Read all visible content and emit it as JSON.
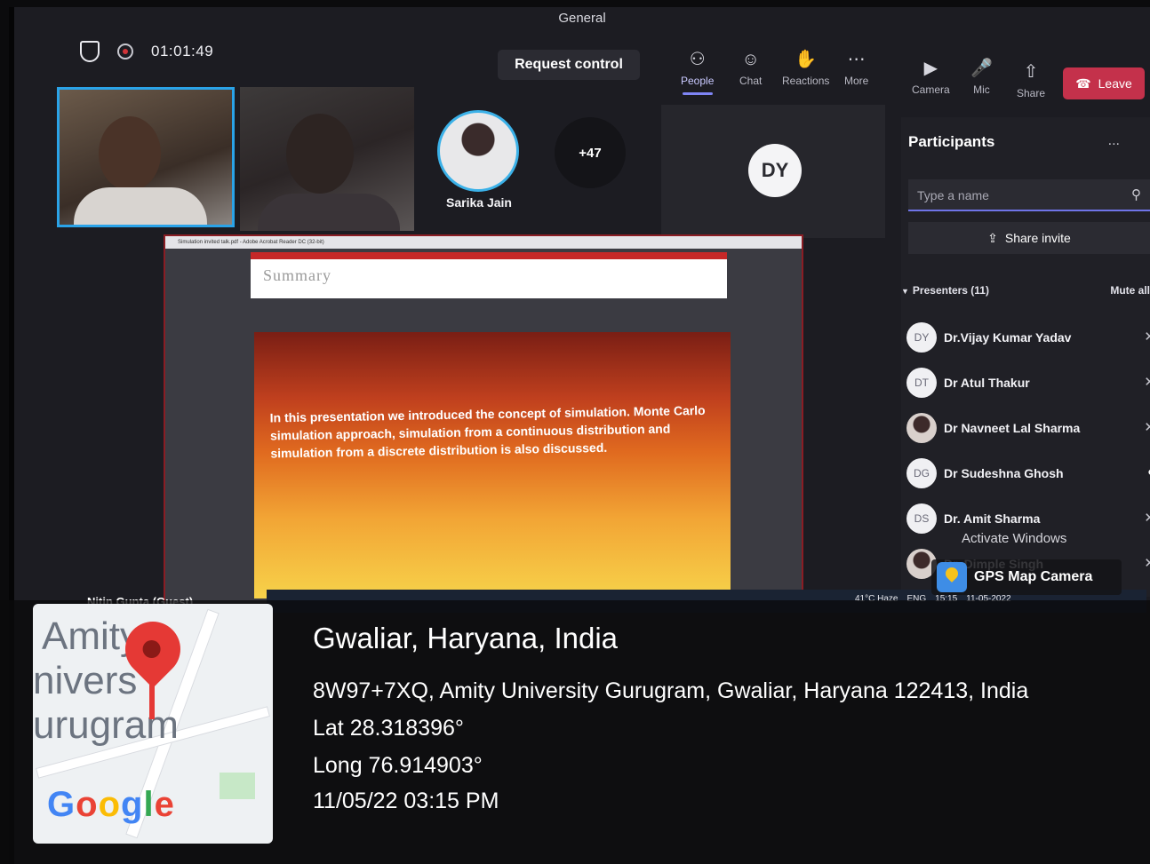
{
  "window": {
    "title": "General"
  },
  "meeting": {
    "timer": "01:01:49",
    "request_control": "Request control"
  },
  "toolbar": {
    "people": "People",
    "chat": "Chat",
    "reactions": "Reactions",
    "more": "More",
    "camera": "Camera",
    "mic": "Mic",
    "share": "Share",
    "leave": "Leave"
  },
  "stage": {
    "sarika_name": "Sarika Jain",
    "overflow_count": "+47",
    "dy_initials": "DY",
    "presenter_label": "Nitin Gupta (Guest)"
  },
  "shared_screen": {
    "acrobat_title": "Simulation invited talk.pdf - Adobe Acrobat Reader DC (32-bit)",
    "slide_heading": "Summary",
    "slide_text": "In this presentation we introduced the concept of simulation. Monte Carlo simulation approach, simulation from a continuous distribution and simulation from a discrete distribution is also discussed."
  },
  "participants": {
    "title": "Participants",
    "more": "...",
    "search_placeholder": "Type a name",
    "share_invite": "Share invite",
    "presenters_header": "Presenters (11)",
    "mute_all": "Mute all",
    "list": [
      {
        "initials": "DY",
        "name": "Dr.Vijay Kumar Yadav"
      },
      {
        "initials": "DT",
        "name": "Dr Atul Thakur"
      },
      {
        "initials": "",
        "name": "Dr Navneet Lal Sharma"
      },
      {
        "initials": "DG",
        "name": "Dr Sudeshna Ghosh"
      },
      {
        "initials": "DS",
        "name": "Dr. Amit Sharma"
      },
      {
        "initials": "",
        "name": "Dr. Dimple Singh"
      }
    ]
  },
  "system": {
    "activate_windows": "Activate Windows",
    "weather": "41°C Haze",
    "lang": "ENG",
    "clock": "15:15",
    "date": "11-05-2022"
  },
  "gps": {
    "app_label": "GPS Map Camera",
    "place": "Gwaliar, Haryana, India",
    "address": "8W97+7XQ, Amity University Gurugram, Gwaliar, Haryana 122413, India",
    "lat": "Lat 28.318396°",
    "long": "Long 76.914903°",
    "datetime": "11/05/22 03:15 PM",
    "map_text_1": "Amity",
    "map_text_2": "nivers",
    "map_text_3": "urugram"
  }
}
